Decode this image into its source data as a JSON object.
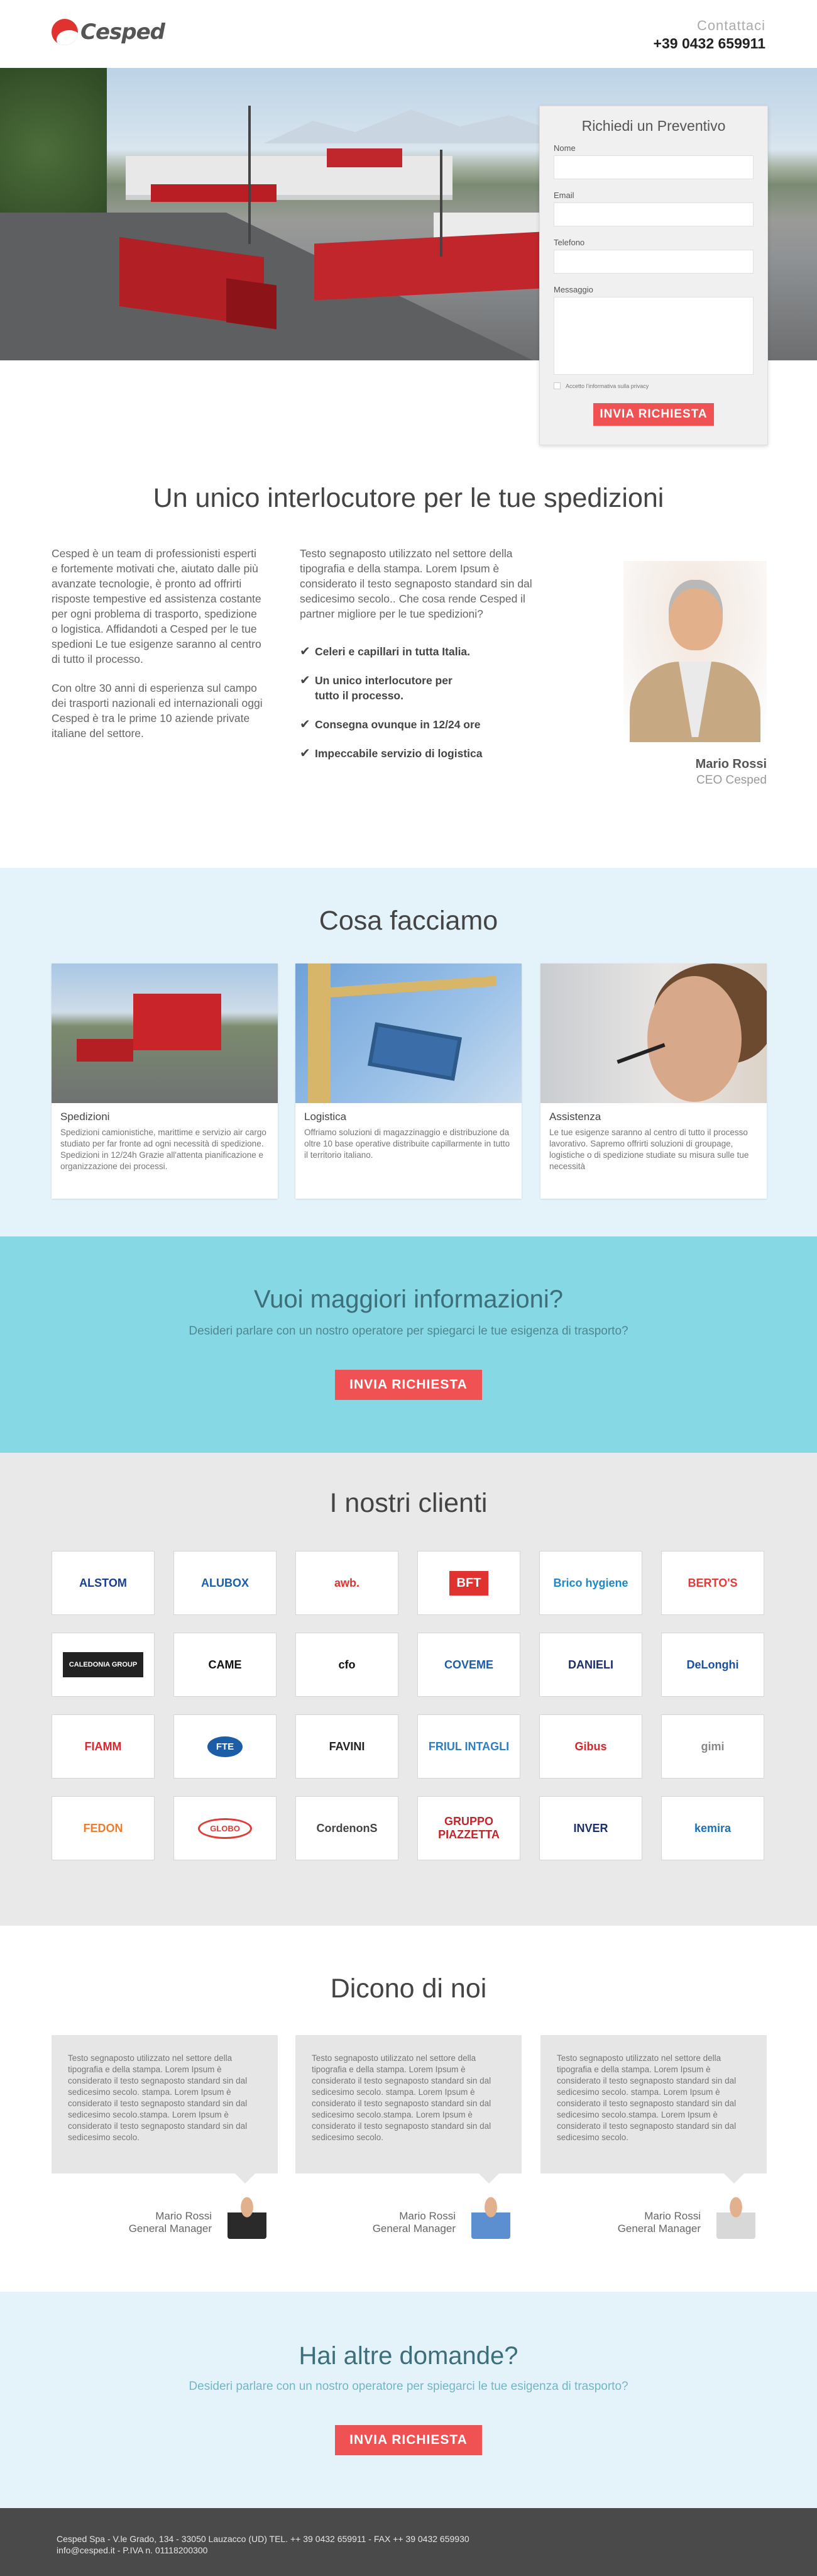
{
  "header": {
    "brand": "Cesped",
    "contact_label": "Contattaci",
    "phone": "+39 0432 659911"
  },
  "form": {
    "title": "Richiedi un Preventivo",
    "name_label": "Nome",
    "email_label": "Email",
    "phone_label": "Telefono",
    "message_label": "Messaggio",
    "privacy_label": "Accetto l'informativa sulla privacy",
    "submit_label": "INVIA RICHIESTA"
  },
  "intro": {
    "title": "Un unico interlocutore per le tue spedizioni",
    "left_p1": "Cesped è un team di professionisti esperti e fortemente motivati che, aiutato dalle più avanzate tecnologie, è pronto ad offrirti risposte tempestive ed assistenza costante per ogni problema di trasporto, spedizione o logistica. Affidandoti a Cesped per le tue spedioni Le tue esigenze saranno al centro di tutto il processo.",
    "left_p2": "Con oltre 30 anni di esperienza sul campo dei trasporti nazionali ed internazionali oggi Cesped è tra le prime 10 aziende private italiane del settore.",
    "mid_p": "Testo segnaposto utilizzato nel settore della tipografia e della stampa. Lorem Ipsum è considerato il testo segnaposto standard sin dal sedicesimo secolo.. Che cosa rende Cesped il partner migliore per le tue spedizioni?",
    "checks": [
      "Celeri e capillari in tutta Italia.",
      "Un unico interlocutore per tutto il processo.",
      "Consegna ovunque in 12/24 ore",
      "Impeccabile servizio di logistica"
    ],
    "person_name": "Mario Rossi",
    "person_role": "CEO Cesped"
  },
  "services": {
    "title": "Cosa facciamo",
    "cards": [
      {
        "title": "Spedizioni",
        "text": "Spedizioni camionistiche, marittime e servizio air cargo studiato per far fronte ad ogni necessità di spedizione. Spedizioni in 12/24h Grazie all'attenta pianificazione e organizzazione dei processi."
      },
      {
        "title": "Logistica",
        "text": "Offriamo soluzioni di magazzinaggio e distribuzione da oltre 10 base operative distribuite capillarmente in tutto il territorio italiano."
      },
      {
        "title": "Assistenza",
        "text": "Le tue esigenze saranno al centro di tutto il processo lavorativo. Sapremo offrirti soluzioni di groupage, logistiche o di spedizione studiate su misura sulle tue necessità"
      }
    ]
  },
  "cta1": {
    "title": "Vuoi maggiori informazioni?",
    "subtitle": "Desideri parlare con un nostro operatore per spiegarci le tue esigenza di trasporto?",
    "button": "INVIA RICHIESTA"
  },
  "clients": {
    "title": "I nostri clienti",
    "logos": [
      "ALSTOM",
      "ALUBOX",
      "awb.",
      "BFT",
      "Brico hygiene",
      "BERTO'S",
      "CALEDONIA GROUP",
      "CAME",
      "cfo",
      "COVEME",
      "DANIELI",
      "DeLonghi",
      "FIAMM",
      "FTE",
      "FAVINI",
      "FRIUL INTAGLI",
      "Gibus",
      "gimi",
      "FEDON",
      "GLOBO",
      "CordenonS",
      "GRUPPO PIAZZETTA",
      "INVER",
      "kemira"
    ],
    "colors": [
      "#1a3e8a",
      "#1c5da8",
      "#e0322f",
      "#ffffff",
      "#1c87c9",
      "#e23a37",
      "#ffffff",
      "#111111",
      "#111111",
      "#1c5da8",
      "#1b2f6b",
      "#1b4fa0",
      "#d8262c",
      "#1c5da8",
      "#222222",
      "#2f7fbf",
      "#d8262c",
      "#888888",
      "#f07c2a",
      "#e23a37",
      "#444444",
      "#c0272d",
      "#1b2f6b",
      "#1c6fb7"
    ]
  },
  "testimonials": {
    "title": "Dicono di noi",
    "items": [
      {
        "text": "Testo segnaposto utilizzato nel settore della tipografia e della stampa. Lorem Ipsum è considerato il testo segnaposto standard sin dal sedicesimo secolo. stampa. Lorem Ipsum è considerato il testo segnaposto standard sin dal sedicesimo secolo.stampa. Lorem Ipsum è considerato il testo segnaposto standard sin dal sedicesimo secolo.",
        "name": "Mario Rossi",
        "role": "General Manager"
      },
      {
        "text": "Testo segnaposto utilizzato nel settore della tipografia e della stampa. Lorem Ipsum è considerato il testo segnaposto standard sin dal sedicesimo secolo. stampa. Lorem Ipsum è considerato il testo segnaposto standard sin dal sedicesimo secolo.stampa. Lorem Ipsum è considerato il testo segnaposto standard sin dal sedicesimo secolo.",
        "name": "Mario Rossi",
        "role": "General Manager"
      },
      {
        "text": "Testo segnaposto utilizzato nel settore della tipografia e della stampa. Lorem Ipsum è considerato il testo segnaposto standard sin dal sedicesimo secolo. stampa. Lorem Ipsum è considerato il testo segnaposto standard sin dal sedicesimo secolo.stampa. Lorem Ipsum è considerato il testo segnaposto standard sin dal sedicesimo secolo.",
        "name": "Mario Rossi",
        "role": "General Manager"
      }
    ]
  },
  "cta2": {
    "title": "Hai altre domande?",
    "subtitle": "Desideri parlare con un nostro operatore per spiegarci le tue esigenza di trasporto?",
    "button": "INVIA RICHIESTA"
  },
  "footer": {
    "line1": "Cesped Spa - V.le Grado, 134 - 33050 Lauzacco (UD) TEL. ++ 39 0432 659911 - FAX ++ 39 0432 659930",
    "line2": "info@cesped.it - P.IVA n. 01118200300"
  },
  "colors": {
    "accent": "#f05253",
    "brand_red": "#e0322f",
    "light_blue_bg": "#e4f2fa",
    "cyan_bg": "#86d8e5",
    "gray_bg": "#e9e9e9",
    "footer_bg": "#4a4a4a"
  }
}
